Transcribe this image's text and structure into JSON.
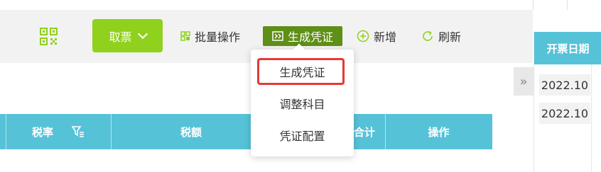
{
  "colors": {
    "accent_green": "#8fd11c",
    "dark_green": "#5e8f16",
    "header_teal": "#56c2d8",
    "highlight_red": "#e53935"
  },
  "toolbar": {
    "qr_icon": "qrcode-icon",
    "take_ticket": "取票",
    "batch": "批量操作",
    "batch_icon": "grid-icon",
    "generate_voucher": "生成凭证",
    "voucher_icon": "voucher-icon",
    "add": "新增",
    "add_icon": "plus-circle-icon",
    "refresh": "刷新",
    "refresh_icon": "refresh-icon"
  },
  "dropdown": {
    "items": [
      "生成凭证",
      "调整科目",
      "凭证配置"
    ]
  },
  "table": {
    "headers": [
      "税率",
      "税额",
      "合计",
      "操作"
    ],
    "filter_icon": "filter-icon"
  },
  "right_panel": {
    "header": "开票日期",
    "collapse_glyph": "»",
    "dates": [
      "2022.10",
      "2022.10"
    ]
  }
}
